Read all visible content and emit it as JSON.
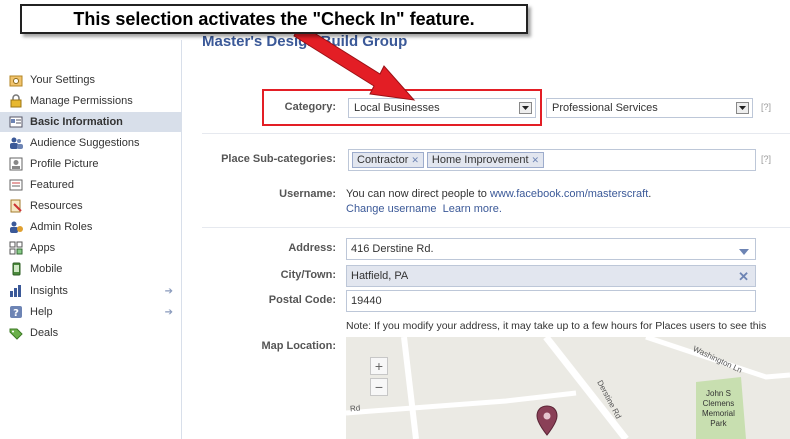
{
  "page": {
    "title": "Master's Design Build Group"
  },
  "callout": {
    "text": "This selection activates the \"Check In\" feature."
  },
  "sidebar": {
    "items": [
      {
        "label": "Your Settings",
        "icon": "settings-icon",
        "active": false,
        "arrow": false
      },
      {
        "label": "Manage Permissions",
        "icon": "lock-icon",
        "active": false,
        "arrow": false
      },
      {
        "label": "Basic Information",
        "icon": "info-card-icon",
        "active": true,
        "arrow": false
      },
      {
        "label": "Audience Suggestions",
        "icon": "users-icon",
        "active": false,
        "arrow": false
      },
      {
        "label": "Profile Picture",
        "icon": "picture-icon",
        "active": false,
        "arrow": false
      },
      {
        "label": "Featured",
        "icon": "featured-icon",
        "active": false,
        "arrow": false
      },
      {
        "label": "Resources",
        "icon": "resources-icon",
        "active": false,
        "arrow": false
      },
      {
        "label": "Admin Roles",
        "icon": "admin-icon",
        "active": false,
        "arrow": false
      },
      {
        "label": "Apps",
        "icon": "apps-icon",
        "active": false,
        "arrow": false
      },
      {
        "label": "Mobile",
        "icon": "mobile-icon",
        "active": false,
        "arrow": false
      },
      {
        "label": "Insights",
        "icon": "insights-icon",
        "active": false,
        "arrow": true
      },
      {
        "label": "Help",
        "icon": "help-icon",
        "active": false,
        "arrow": true
      },
      {
        "label": "Deals",
        "icon": "deals-icon",
        "active": false,
        "arrow": false
      }
    ],
    "arrow_glyph": "➔"
  },
  "form": {
    "category": {
      "label": "Category:",
      "value": "Local Businesses",
      "sub_value": "Professional Services",
      "help": "[?]"
    },
    "subcategories": {
      "label": "Place Sub-categories:",
      "tokens": [
        "Contractor",
        "Home Improvement"
      ],
      "remove_glyph": "✕",
      "help": "[?]"
    },
    "username": {
      "label": "Username:",
      "text": "You can now direct people to",
      "url": "www.facebook.com/masterscraft",
      "period": ".",
      "change_link": "Change username",
      "learn_link": "Learn more."
    },
    "address": {
      "label": "Address:",
      "value": "416 Derstine Rd."
    },
    "city": {
      "label": "City/Town:",
      "value": "Hatfield, PA"
    },
    "postal": {
      "label": "Postal Code:",
      "value": "19440"
    },
    "note": "Note: If you modify your address, it may take up to a few hours for Places users to see this",
    "map": {
      "label": "Map Location:",
      "zoom_in": "+",
      "zoom_out": "−",
      "streets": [
        "Derstine Rd",
        "Washington Ln",
        "Rd"
      ],
      "park": [
        "John S",
        "Clemens",
        "Memorial",
        "Park"
      ]
    }
  },
  "colors": {
    "accent": "#3b5998",
    "highlight": "#e31e25",
    "arrow": "#e31e25",
    "selected_sidebar": "#d8dfea"
  }
}
